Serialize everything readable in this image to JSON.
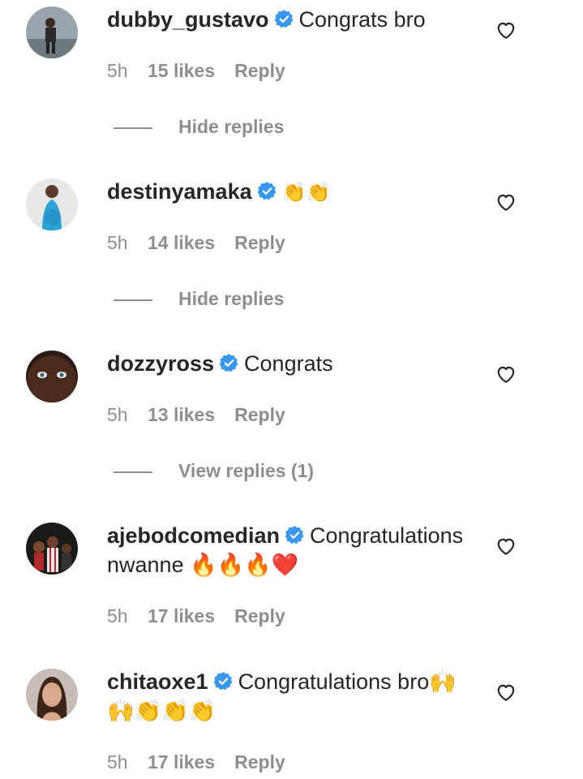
{
  "colors": {
    "text": "#262626",
    "secondary": "#8e8e8e",
    "verified": "#3897f0",
    "background": "#ffffff"
  },
  "comments": [
    {
      "username": "dubby_gustavo",
      "verified": true,
      "text": "Congrats bro",
      "time": "5h",
      "likes": "15 likes",
      "reply": "Reply",
      "replies_toggle": "Hide replies",
      "avatar_icon": "avatar-person-street"
    },
    {
      "username": "destinyamaka",
      "verified": true,
      "text": "👏👏",
      "time": "5h",
      "likes": "14 likes",
      "reply": "Reply",
      "replies_toggle": "Hide replies",
      "avatar_icon": "avatar-woman-blue-dress"
    },
    {
      "username": "dozzyross",
      "verified": true,
      "text": "Congrats",
      "time": "5h",
      "likes": "13 likes",
      "reply": "Reply",
      "replies_toggle": "View replies (1)",
      "avatar_icon": "avatar-face-closeup"
    },
    {
      "username": "ajebodcomedian",
      "verified": true,
      "text": "Congratulations nwanne 🔥🔥🔥❤️",
      "time": "5h",
      "likes": "17 likes",
      "reply": "Reply",
      "avatar_icon": "avatar-group"
    },
    {
      "username": "chitaoxe1",
      "verified": true,
      "text": "Congratulations bro🙌🙌👏👏👏",
      "time": "5h",
      "likes": "17 likes",
      "reply": "Reply",
      "avatar_icon": "avatar-woman-portrait"
    }
  ]
}
